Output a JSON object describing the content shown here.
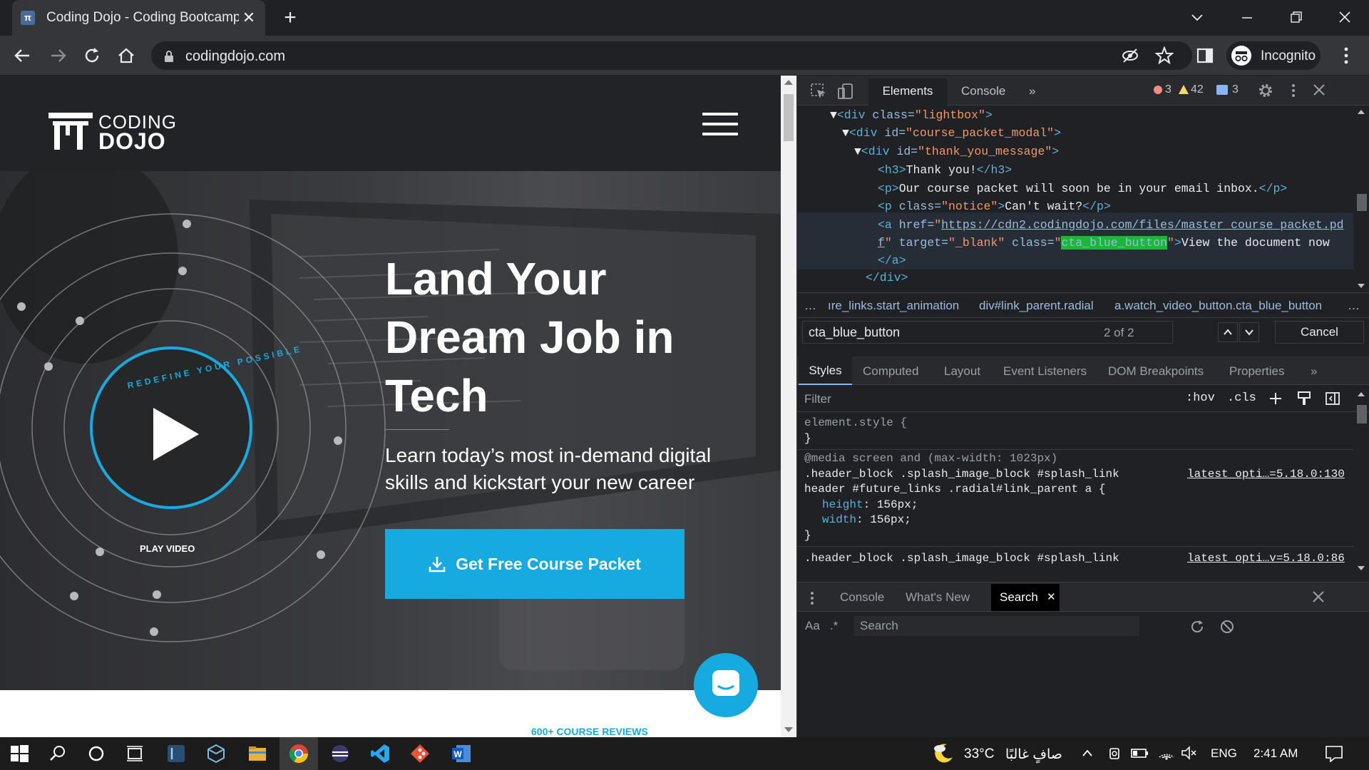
{
  "browser": {
    "tab_title": "Coding Dojo - Coding Bootcamp",
    "tab_favicon_glyph": "π",
    "url": "codingdojo.com",
    "profile_label": "Incognito"
  },
  "site": {
    "logo_line1": "CODING",
    "logo_line2": "DOJO",
    "hero_title": "Land Your Dream Job in Tech",
    "hero_subtitle": "Learn today’s most in-demand digital skills and kickstart your new career",
    "cta_label": "Get Free Course Packet",
    "play_ring_text": "REDEFINE YOUR POSSIBLE",
    "play_label": "PLAY VIDEO",
    "reviews_peek": "600+ COURSE REVIEWS"
  },
  "devtools": {
    "tabs": [
      "Elements",
      "Console",
      "»"
    ],
    "error_count": "3",
    "warning_count": "42",
    "info_count": "3",
    "dom": {
      "l1_tag": "<div",
      "l1_attr": " class=",
      "l1_val": "\"lightbox\"",
      "l1_end": ">",
      "l2_tag": "<div",
      "l2_attr": " id=",
      "l2_val": "\"course_packet_modal\"",
      "l2_end": ">",
      "l3_tag": "<div",
      "l3_attr": " id=",
      "l3_val": "\"thank_you_message\"",
      "l3_end": ">",
      "l4_open": "<h3>",
      "l4_text": "Thank you!",
      "l4_close": "</h3>",
      "l5_open": "<p>",
      "l5_text": "Our course packet will soon be in your email inbox.",
      "l5_close": "</p>",
      "l6_tag": "<p",
      "l6_attr": " class=",
      "l6_val": "\"notice\"",
      "l6_end": ">",
      "l6_text": "Can't wait?",
      "l6_close": "</p>",
      "l7_tag": "<a",
      "l7_attr": " href=",
      "l7_quote": "\"",
      "l7_link": "https://cdn2.codingdojo.com/files/master_course_packet.pd",
      "l8_link": "f",
      "l8_quote": "\"",
      "l8_attr1": " target=",
      "l8_val1": "\"_blank\"",
      "l8_attr2": " class=",
      "l8_q1": "\"",
      "l8_hl": "cta_blue_button",
      "l8_q2": "\"",
      "l8_end": ">",
      "l8_text": "View the document now",
      "l9_close": "</a>",
      "l10_close": "</div>",
      "l11_more": "..."
    },
    "breadcrumbs": [
      "…",
      "ıre_links.start_animation",
      "div#link_parent.radial",
      "a.watch_video_button.cta_blue_button",
      "…"
    ],
    "search_value": "cta_blue_button",
    "search_count": "2 of 2",
    "cancel_label": "Cancel",
    "styles_tabs": [
      "Styles",
      "Computed",
      "Layout",
      "Event Listeners",
      "DOM Breakpoints",
      "Properties",
      "»"
    ],
    "filter_placeholder": "Filter",
    "hov_label": ":hov",
    "cls_label": ".cls",
    "styles": {
      "element_style": "element.style {",
      "close_brace": "}",
      "media": "@media screen and (max-width: 1023px)",
      "rule1_sel1": ".header_block .splash_image_block #splash_link",
      "rule1_src": "latest_opti…=5.18.0:130",
      "rule1_sel2": "header #future_links .radial#link_parent a {",
      "prop1_name": "height",
      "prop1_val": ": 156px;",
      "prop2_name": "width",
      "prop2_val": ": 156px;",
      "rule2_sel1": ".header_block .splash_image_block #splash_link",
      "rule2_src": "latest_opti…v=5.18.0:86"
    },
    "drawer_tabs": [
      "Console",
      "What's New",
      "Search"
    ],
    "drawer_case_label": "Aa",
    "drawer_regex_label": ".*",
    "drawer_search_placeholder": "Search"
  },
  "taskbar": {
    "weather_temp": "33°C",
    "weather_desc": "صافٍ غالبًا",
    "language": "ENG",
    "time": "2:41 AM"
  },
  "colors": {
    "brand_blue": "#16aae0",
    "chrome_dark": "#202124",
    "selection_green": "#1cb73a"
  }
}
